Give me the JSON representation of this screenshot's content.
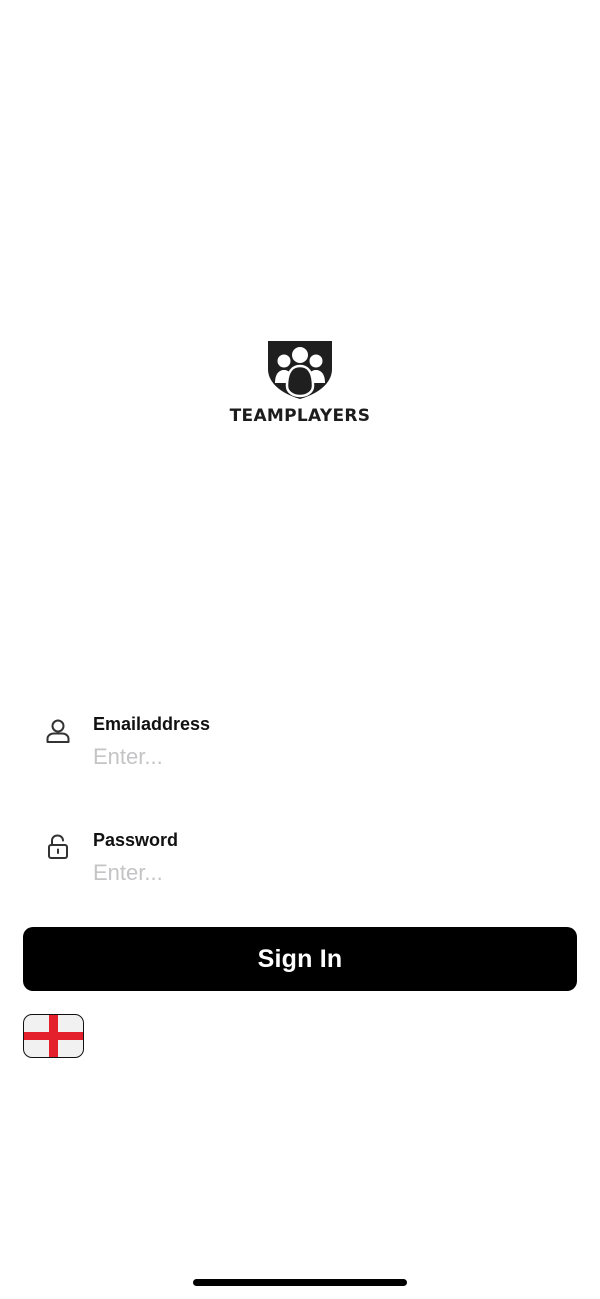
{
  "brand": {
    "name": "TEAMPLAYERS",
    "logo_icon": "shield-team-icon"
  },
  "form": {
    "email": {
      "label": "Emailaddress",
      "placeholder": "Enter...",
      "value": "",
      "icon": "user-icon"
    },
    "password": {
      "label": "Password",
      "placeholder": "Enter...",
      "value": "",
      "icon": "unlock-icon"
    },
    "submit_label": "Sign In"
  },
  "language": {
    "selected": "England",
    "icon": "england-flag-icon"
  },
  "colors": {
    "background": "#ffffff",
    "button": "#000000",
    "button_text": "#ffffff",
    "placeholder": "#c4c4c6",
    "flag_cross": "#e3202c"
  }
}
